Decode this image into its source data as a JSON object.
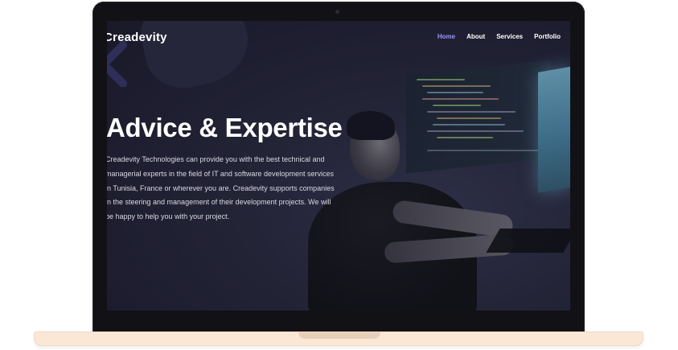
{
  "nav": {
    "brand": "Creadevity",
    "items": [
      {
        "label": "Home",
        "active": true
      },
      {
        "label": "About",
        "active": false
      },
      {
        "label": "Services",
        "active": false
      },
      {
        "label": "Portfolio",
        "active": false
      }
    ]
  },
  "hero": {
    "title": "Advice & Expertise",
    "text": "Creadevity Technologies can provide you with the best technical and managerial experts in the field of IT and software development services in Tunisia, France or wherever you are. Creadevity supports companies in the steering and management of their development projects. We will be happy to help you with your project."
  },
  "colors": {
    "accent": "#9b95ff",
    "screen_bg": "#1d1d2f",
    "laptop_base": "#fbe7d5",
    "bezel": "#111116"
  },
  "icons": {
    "chevron": "chevron-left-icon"
  }
}
